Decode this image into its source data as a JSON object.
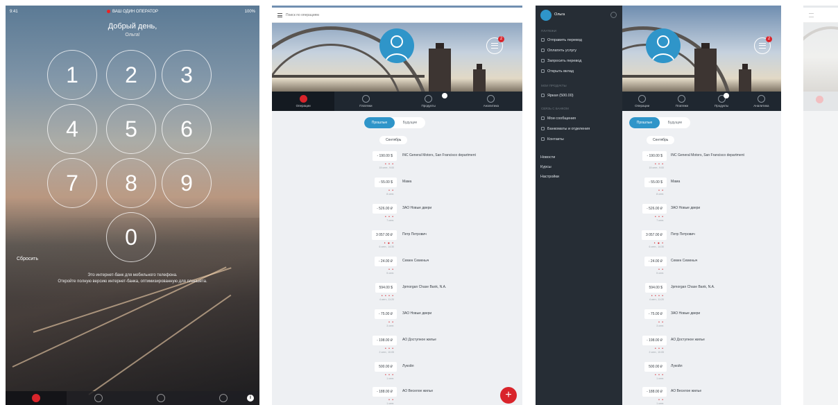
{
  "login": {
    "status_time": "9:41",
    "carrier": "ВАШ ОДИН ОПЕРАТОР",
    "battery": "100%",
    "greeting": "Добрый день,",
    "username": "Ольга!",
    "keys": [
      "1",
      "2",
      "3",
      "4",
      "5",
      "6",
      "7",
      "8",
      "9",
      "0"
    ],
    "clear_label": "Сбросить",
    "notice_line1": "Это интернет-банк для мобильного телефона.",
    "notice_line2": "Откройте полную версию интернет-банка, оптимизированную для планшета."
  },
  "app": {
    "search_placeholder": "Поиск по операциям",
    "message_badge": "2",
    "tabs": [
      {
        "label": "Операции",
        "icon": "operations-icon"
      },
      {
        "label": "Платежи",
        "icon": "payments-icon"
      },
      {
        "label": "Продукты",
        "icon": "products-icon"
      },
      {
        "label": "Аналитика",
        "icon": "analytics-icon"
      }
    ],
    "segments": [
      "Прошлые",
      "Будущие"
    ],
    "month": "Сентябрь",
    "transactions": [
      {
        "amount": "- 190.00 $",
        "dots": "• • •",
        "sub": "15 сент., 9:00",
        "name": "INC General Motors, San Francisco department"
      },
      {
        "amount": "- 55.00 $",
        "dots": "• •",
        "sub": "8 сент.",
        "name": "Мама"
      },
      {
        "amount": "- 526.00 ₽",
        "dots": "• • •",
        "sub": "7 сент.",
        "name": "ЗАО Новые двери"
      },
      {
        "amount": "3 057.00 ₽",
        "dots": "• ● •",
        "sub": "6 сент., 14:30",
        "name": "Петр Петрович"
      },
      {
        "amount": "- 24.00 ₽",
        "dots": "• •",
        "sub": "5 сент.",
        "name": "Семен Семеныч"
      },
      {
        "amount": "594.00 $",
        "dots": "• • • •",
        "sub": "4 сент., 11:20",
        "name": "Jpmorgan Chase Bank, N.A."
      },
      {
        "amount": "- 75.00 ₽",
        "dots": "• •",
        "sub": "3 сент.",
        "name": "ЗАО Новые двери"
      },
      {
        "amount": "- 198.00 ₽",
        "dots": "• • •",
        "sub": "2 сент., 10:05",
        "name": "АО Доступное жилье"
      },
      {
        "amount": "500.00 ₽",
        "dots": "• • •",
        "sub": "1 сент.",
        "name": "Лукойл"
      },
      {
        "amount": "- 188.00 ₽",
        "dots": "• •",
        "sub": "1 сент.",
        "name": "АО Веселое жилье"
      }
    ],
    "fab_label": "+"
  },
  "drawer": {
    "username": "Ольга",
    "section_transfers": "ПЛАТЕЖИ",
    "items_main": [
      "Отправить перевод",
      "Оплатить услугу",
      "Запросить перевод",
      "Открыть вклад"
    ],
    "section_cards": "МОИ ПРОДУКТЫ",
    "card_item": "Яркая (500.00)",
    "section_other": "СВЯЗЬ С БАНКОМ",
    "items_other": [
      "Мои сообщения",
      "Банкоматы и отделения",
      "Контакты"
    ],
    "items_plain": [
      "Новости",
      "Курсы",
      "Настройки"
    ]
  }
}
